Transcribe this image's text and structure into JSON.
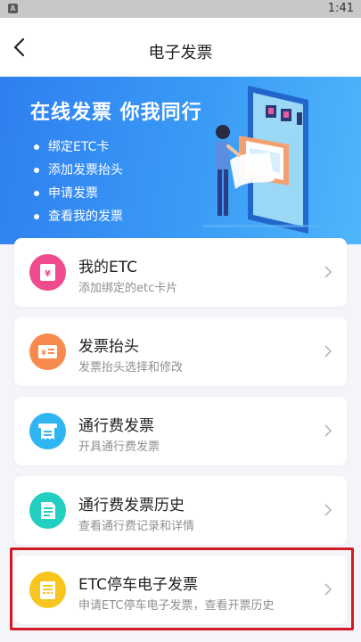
{
  "status_bar": {
    "time": "1:41",
    "app_glyph": "A"
  },
  "nav": {
    "title": "电子发票",
    "back_icon": "chevron-left-icon"
  },
  "banner": {
    "title": "在线发票 你我同行",
    "bullets": [
      "绑定ETC卡",
      "添加发票抬头",
      "申请发票",
      "查看我的发票"
    ]
  },
  "menu": [
    {
      "title": "我的ETC",
      "subtitle": "添加绑定的etc卡片",
      "icon": "yen-card-icon",
      "color": "#f04b8f"
    },
    {
      "title": "发票抬头",
      "subtitle": "发票抬头选择和修改",
      "icon": "invoice-title-icon",
      "color": "#f98a4e"
    },
    {
      "title": "通行费发票",
      "subtitle": "开具通行费发票",
      "icon": "receipt-icon",
      "color": "#2fb5f2"
    },
    {
      "title": "通行费发票历史",
      "subtitle": "查看通行费记录和详情",
      "icon": "history-document-icon",
      "color": "#22cfc0"
    },
    {
      "title": "ETC停车电子发票",
      "subtitle": "申请ETC停车电子发票，查看开票历史",
      "icon": "parking-invoice-icon",
      "color": "#f7c61e"
    }
  ]
}
